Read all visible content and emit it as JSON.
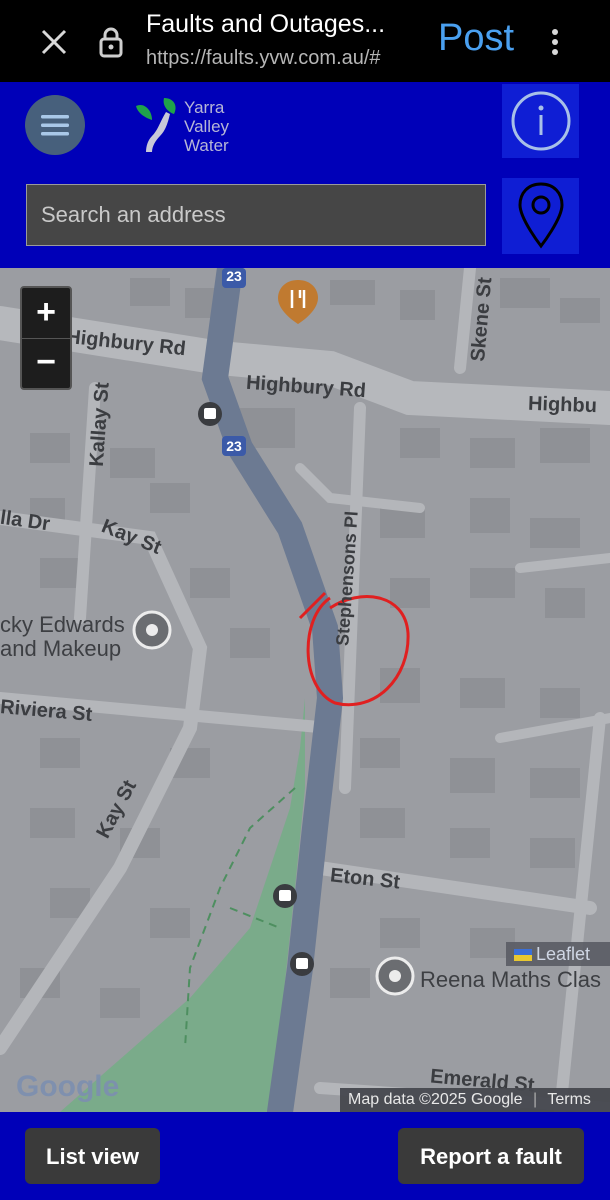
{
  "browser": {
    "title": "Faults and Outages...",
    "url": "https://faults.yvw.com.au/#",
    "post_label": "Post",
    "icons": {
      "close": "close-icon",
      "lock": "lock-icon",
      "more": "more-vert-icon"
    }
  },
  "header": {
    "logo_text": [
      "Yarra",
      "Valley",
      "Water"
    ],
    "menu_icon": "hamburger-icon",
    "info_icon": "info-icon",
    "locate_icon": "location-pin-icon",
    "colors": {
      "header_bg": "#0000b8",
      "button_bg": "#0f1ed4"
    }
  },
  "search": {
    "placeholder": "Search an address",
    "value": ""
  },
  "map": {
    "zoom_in": "+",
    "zoom_out": "−",
    "route_shields": [
      "23",
      "23"
    ],
    "street_labels": {
      "highbury_rd_left": "Highbury Rd",
      "highbury_rd_mid": "Highbury Rd",
      "highbury_rd_right": "Highbu",
      "skene_st": "Skene St",
      "kallay_st": "Kallay St",
      "kay_st_top": "Kay St",
      "la_dr": "lla Dr",
      "stephensons_pl": "Stephensons Pl",
      "riviera_st": "Riviera St",
      "kay_st_lower": "Kay St",
      "eton_st": "Eton St",
      "emerald_st": "Emerald St"
    },
    "poi": {
      "vicky_edwards": [
        "cky Edwards",
        "and Makeup"
      ],
      "reena": "Reena Maths Clas"
    },
    "attribution_leaflet": "Leaflet",
    "attribution_mapdata": "Map data ©2025 Google",
    "attribution_terms": "Terms",
    "google_logo": "Google"
  },
  "footer": {
    "list_view_label": "List view",
    "report_fault_label": "Report a fault"
  }
}
